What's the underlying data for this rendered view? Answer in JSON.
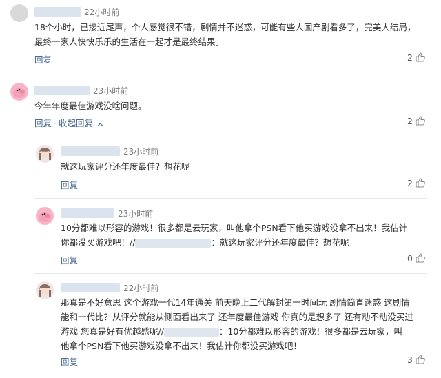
{
  "comments": [
    {
      "time": "22小时前",
      "text": "18个小时，已接近尾声，个人感觉很不错，剧情并不迷惑，可能有些人国产剧看多了，完美大结局，最终一家人快快乐乐的生活在一起才是最终结果。",
      "reply": "回复",
      "likes": "2"
    },
    {
      "time": "23小时前",
      "text": "今年年度最佳游戏没啥问题。",
      "reply": "回复",
      "collapse": "收起回复",
      "likes": "2"
    }
  ],
  "replies": [
    {
      "time": "23小时前",
      "text": "就这玩家评分还年度最佳？想花呢",
      "reply": "回复",
      "likes": "2"
    },
    {
      "time": "23小时前",
      "text_line1": "10分都难以形容的游戏！很多都是云玩家，叫他拿个PSN看下他买游戏没拿不出来！我估计",
      "text_line2_prefix": "你都没买游戏吧！//",
      "text_line2_suffix": "：就这玩家评分还年度最佳？想花呢",
      "reply": "回复",
      "likes": "0"
    },
    {
      "time": "22小时前",
      "text_line1": "那真是不好意思 这个游戏一代14年通关 前天晚上二代解封第一时间玩 剧情简直迷惑 这剧情",
      "text_line2": "能和一代比？从评分就能从侧面看出来了 还年度最佳游戏 你真的是想多了 还有动不动没买过",
      "text_line3_prefix": "游戏 您真是好有优越感呢//",
      "text_line3_suffix": "：10分都难以形容的游戏！很多都是云玩家，叫",
      "text_line4": "他拿个PSN看下他买游戏没拿不出来！我估计你都没买游戏吧！",
      "reply": "回复",
      "likes": "3"
    }
  ],
  "icons": {
    "like": "thumbs-up-icon",
    "chevron": "chevron-up-icon"
  },
  "colors": {
    "link": "#4a6c95",
    "text": "#333333",
    "muted": "#7a7a7a"
  }
}
